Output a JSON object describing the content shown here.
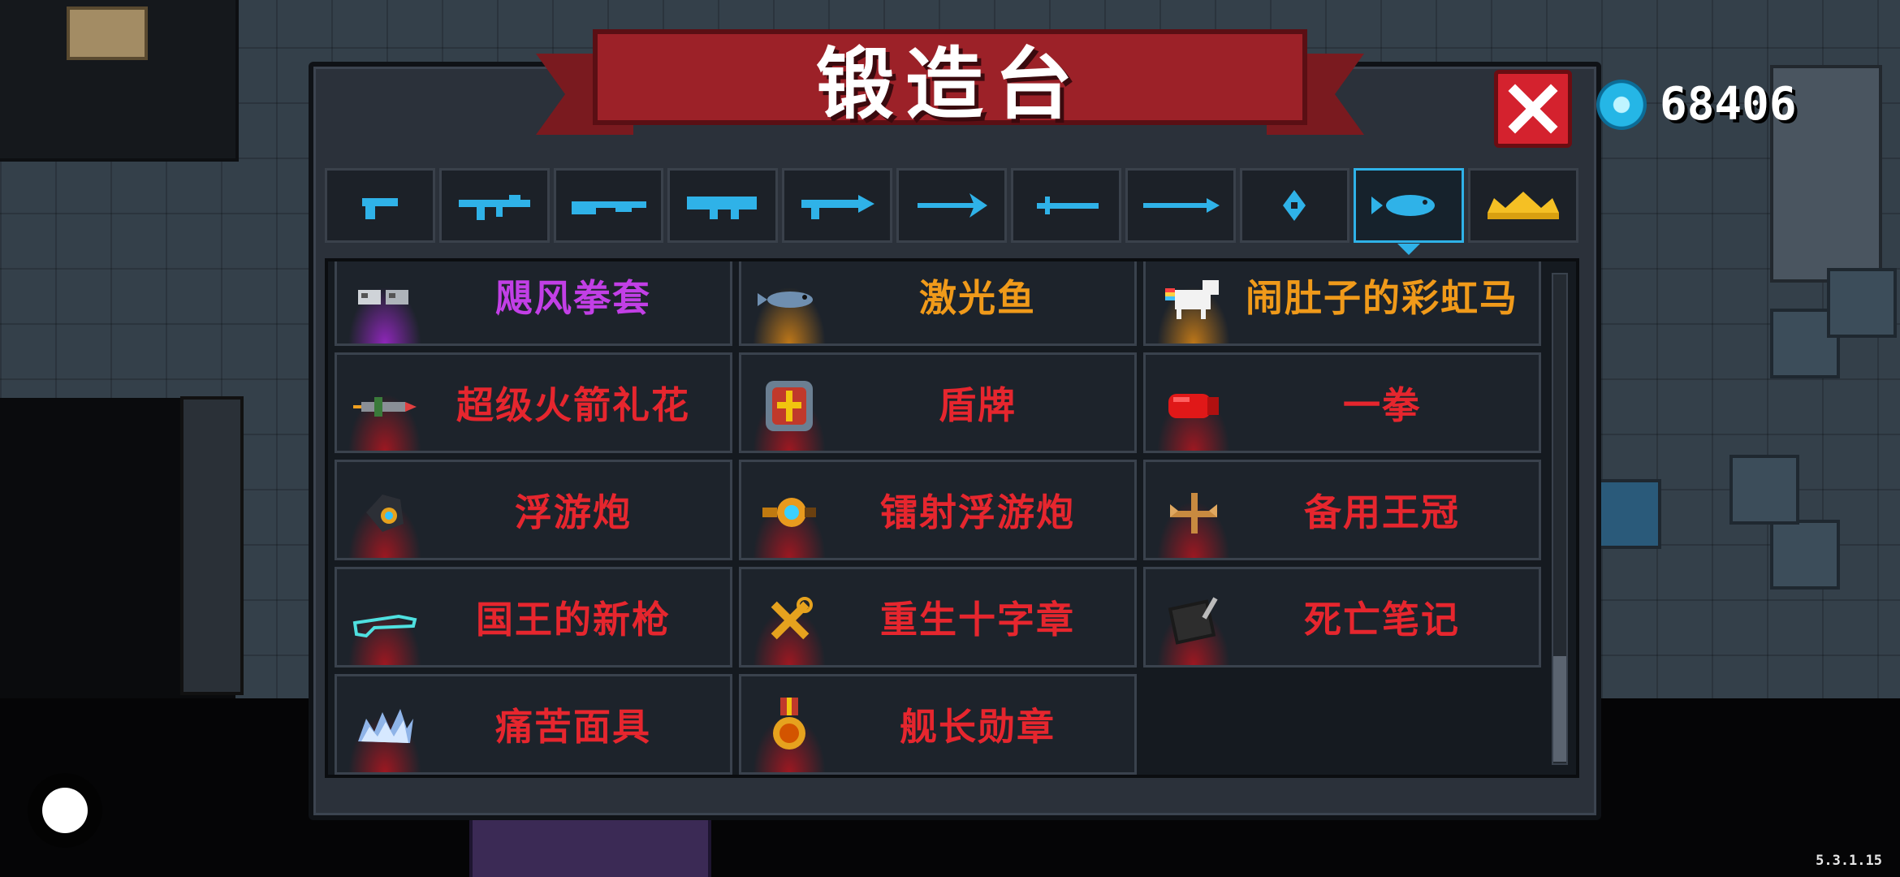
{
  "title": "锻造台",
  "currency": {
    "icon": "gem-icon",
    "amount": "68406"
  },
  "version": "5.3.1.15",
  "tabs": [
    {
      "name": "pistol",
      "active": false
    },
    {
      "name": "rifle",
      "active": false
    },
    {
      "name": "shotgun",
      "active": false
    },
    {
      "name": "launcher",
      "active": false
    },
    {
      "name": "laser",
      "active": false
    },
    {
      "name": "bow",
      "active": false
    },
    {
      "name": "sword",
      "active": false
    },
    {
      "name": "spear",
      "active": false
    },
    {
      "name": "staff",
      "active": false
    },
    {
      "name": "fish",
      "active": true
    },
    {
      "name": "crown",
      "active": false
    }
  ],
  "items": [
    {
      "label": "飓风拳套",
      "icon": "gauntlet-icon",
      "rarity": "purple"
    },
    {
      "label": "激光鱼",
      "icon": "laser-fish-icon",
      "rarity": "orange"
    },
    {
      "label": "闹肚子的彩虹马",
      "icon": "rainbow-horse-icon",
      "rarity": "orange"
    },
    {
      "label": "超级火箭礼花",
      "icon": "rocket-firework-icon",
      "rarity": "red"
    },
    {
      "label": "盾牌",
      "icon": "shield-icon",
      "rarity": "red"
    },
    {
      "label": "一拳",
      "icon": "punch-glove-icon",
      "rarity": "red"
    },
    {
      "label": "浮游炮",
      "icon": "floating-cannon-icon",
      "rarity": "red"
    },
    {
      "label": "镭射浮游炮",
      "icon": "laser-drone-icon",
      "rarity": "red"
    },
    {
      "label": "备用王冠",
      "icon": "spare-crown-icon",
      "rarity": "red"
    },
    {
      "label": "国王的新枪",
      "icon": "kings-gun-icon",
      "rarity": "red"
    },
    {
      "label": "重生十字章",
      "icon": "revive-cross-icon",
      "rarity": "red"
    },
    {
      "label": "死亡笔记",
      "icon": "death-note-icon",
      "rarity": "red"
    },
    {
      "label": "痛苦面具",
      "icon": "pain-mask-icon",
      "rarity": "red"
    },
    {
      "label": "舰长勋章",
      "icon": "captain-medal-icon",
      "rarity": "red"
    }
  ],
  "colors": {
    "accent": "#2fb2e8",
    "red": "#e6262e",
    "purple": "#c23fe6",
    "orange": "#f09a1a",
    "close": "#d4222e"
  }
}
